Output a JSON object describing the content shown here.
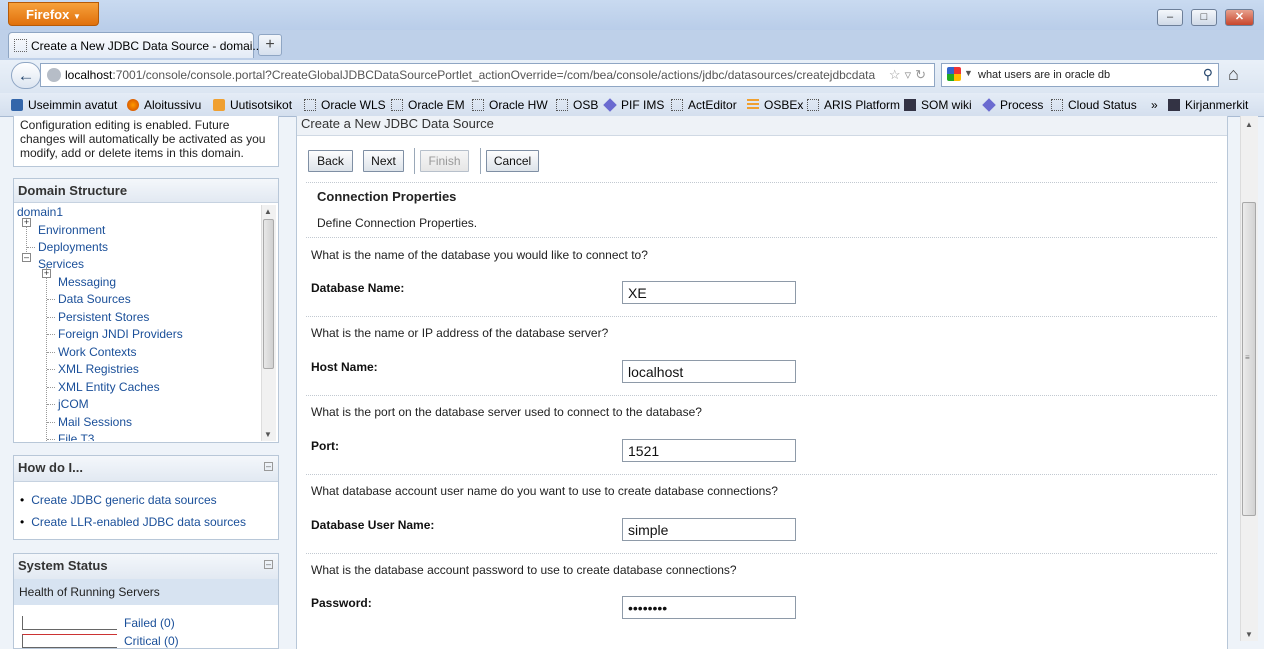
{
  "browser": {
    "menu_button": "Firefox",
    "tab_title": "Create a New JDBC Data Source - domai...",
    "new_tab": "+",
    "url_host": "localhost",
    "url_rest": ":7001/console/console.portal?CreateGlobalJDBCDataSourcePortlet_actionOverride=/com/bea/console/actions/jdbc/datasources/createjdbcdata",
    "search_query": "what users are in oracle db",
    "bookmarks": [
      "Useimmin avatut",
      "Aloitussivu",
      "Uutisotsikot",
      "Oracle WLS",
      "Oracle EM",
      "Oracle HW",
      "OSB",
      "PIF IMS",
      "ActEditor",
      "OSBEx",
      "ARIS Platform",
      "SOM wiki",
      "Process",
      "Cloud Status"
    ],
    "bookmarks_overflow": "»",
    "bookmarks_menu": "Kirjanmerkit"
  },
  "change_center": {
    "text": "Configuration editing is enabled. Future changes will automatically be activated as you modify, add or delete items in this domain."
  },
  "domain_structure": {
    "title": "Domain Structure",
    "tree": {
      "root": "domain1",
      "environment": "Environment",
      "deployments": "Deployments",
      "services": "Services",
      "messaging": "Messaging",
      "data_sources": "Data Sources",
      "persistent_stores": "Persistent Stores",
      "foreign_jndi": "Foreign JNDI Providers",
      "work_contexts": "Work Contexts",
      "xml_registries": "XML Registries",
      "xml_entity_caches": "XML Entity Caches",
      "jcom": "jCOM",
      "mail_sessions": "Mail Sessions",
      "file_t3": "File T3"
    }
  },
  "how_do_i": {
    "title": "How do I...",
    "links": [
      "Create JDBC generic data sources",
      "Create LLR-enabled JDBC data sources"
    ]
  },
  "system_status": {
    "title": "System Status",
    "subheader": "Health of Running Servers",
    "rows": [
      "Failed (0)",
      "Critical (0)"
    ]
  },
  "main": {
    "header": "Create a New JDBC Data Source",
    "buttons": {
      "back": "Back",
      "next": "Next",
      "finish": "Finish",
      "cancel": "Cancel"
    },
    "section_title": "Connection Properties",
    "section_desc": "Define Connection Properties.",
    "fields": {
      "database_name": {
        "question": "What is the name of the database you would like to connect to?",
        "label": "Database Name:",
        "value": "XE"
      },
      "host_name": {
        "question": "What is the name or IP address of the database server?",
        "label": "Host Name:",
        "value": "localhost"
      },
      "port": {
        "question": "What is the port on the database server used to connect to the database?",
        "label": "Port:",
        "value": "1521"
      },
      "user_name": {
        "question": "What database account user name do you want to use to create database connections?",
        "label": "Database User Name:",
        "value": "simple"
      },
      "password": {
        "question": "What is the database account password to use to create database connections?",
        "label": "Password:",
        "value": "simple12"
      }
    }
  }
}
